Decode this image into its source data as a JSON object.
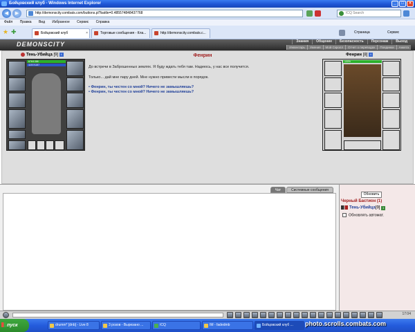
{
  "window": {
    "title": "Бойцовский клуб - Windows Internet Explorer"
  },
  "browser": {
    "address": "http://demonscity.combats.com/buttons.pl?battle=0.485574848437768",
    "search_placeholder": "ICQ Search",
    "menu": [
      "Файл",
      "Правка",
      "Вид",
      "Избранное",
      "Сервис",
      "Справка"
    ],
    "tabs": [
      "Бойцовский клуб",
      "Торговые сообщения - Кла...",
      "http://demonscity.combats.c..."
    ],
    "toolbar": {
      "page": "Страница",
      "tools": "Сервис"
    }
  },
  "game": {
    "logo": "DEMONSCITY",
    "menu_top": [
      "Знания",
      "Общение",
      "Безопасность",
      "Персонаж",
      "Выход"
    ],
    "menu_bottom": [
      "Инвентарь",
      "Умения",
      "Мой Скролл",
      "Отчет о переводах",
      "Поединки",
      "Анкета"
    ],
    "player": {
      "name": "Тень-Убийца",
      "level": "[9]",
      "hp": "676/1358",
      "mp": "1157/1157"
    },
    "npc": {
      "name": "Фенрин",
      "level": "[8]",
      "hp": "100%"
    },
    "dialog": {
      "title": "Фенрин",
      "line1": "До встречи в Заброшенных землях. Я буду ждать тебя там. Надеюсь, у нас все получится.",
      "line2": "Только... дай мне пару дней. Мне нужно привести мысли в порядок.",
      "options": [
        "Фенрин, ты честен со мной? Ничего не замышляешь?",
        "Фенрин, ты честен со мной? Ничего не замышляешь?"
      ]
    },
    "chat": {
      "tabs": [
        "Чат",
        "Системные сообщения"
      ]
    },
    "side": {
      "refresh": "Обновить",
      "location": "Черный Бастион (1)",
      "user": "Тень-Убийца",
      "user_level": "[9]",
      "auto_refresh": "Обновлять автомат."
    },
    "clock": "17:04"
  },
  "taskbar": {
    "start": "пуск",
    "items": [
      "drumm* [dnb] - Live 8",
      "3 розов - Вырезано ...",
      "ICQ",
      "IM - fadedmb",
      "Бойцовский клуб ..."
    ]
  },
  "watermark": "photo.scrolls.combats.com",
  "colors": {
    "accent": "#a01c1c",
    "link": "#1f3f99",
    "hp": "#2bb02b",
    "mp": "#2b52c7"
  }
}
